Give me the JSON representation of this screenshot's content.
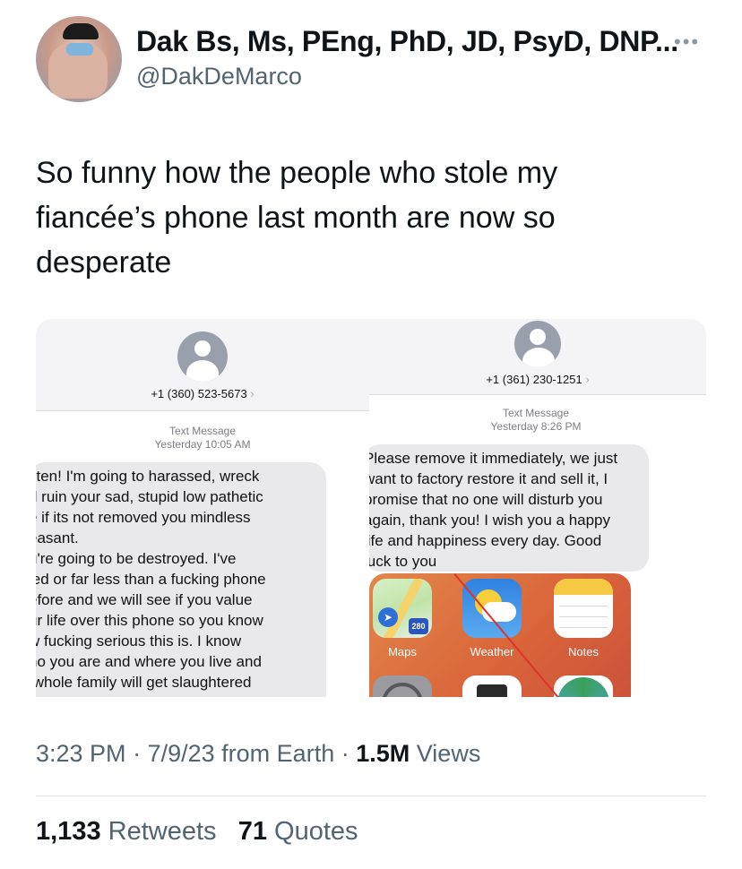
{
  "author": {
    "display_name": "Dak Bs, Ms, PEng, PhD, JD, PsyD, DNP...",
    "handle": "@DakDeMarco",
    "more_icon": "ellipsis-icon"
  },
  "tweet": {
    "text": "So funny how the people who stole my fiancée’s phone last month are now so desperate"
  },
  "screenshots": [
    {
      "phone_number": "+1 (360) 523-5673",
      "label": "Text Message",
      "time": "Yesterday 10:05 AM",
      "message": "sten! I'm going to harassed, wreck\nd ruin your sad, stupid low pathetic\ne if its not removed you mindless\neasant.\nu're going to be destroyed. I've\nled or far less than a fucking phone\nefore and we will see if you value\nur life over this phone so you know\nw fucking serious this is. I know\nho you are and where you live and\n whole family will get slaughtered"
    },
    {
      "phone_number": "+1 (361) 230-1251",
      "label": "Text Message",
      "time": "Yesterday 8:26 PM",
      "message": "Please remove it immediately, we just\nwant to factory restore it and sell it, I\npromise that no one will disturb you\nagain, thank you! I wish you a happy\nlife and happiness every day. Good\nluck to you",
      "apps": [
        "Maps",
        "Weather",
        "Notes"
      ],
      "map_shield": "280"
    }
  ],
  "footer": {
    "time": "3:23 PM",
    "date": "7/9/23",
    "source": "from Earth",
    "views_count": "1.5M",
    "views_label": "Views"
  },
  "stats": {
    "retweets_count": "1,133",
    "retweets_label": "Retweets",
    "quotes_count": "71",
    "quotes_label": "Quotes"
  }
}
